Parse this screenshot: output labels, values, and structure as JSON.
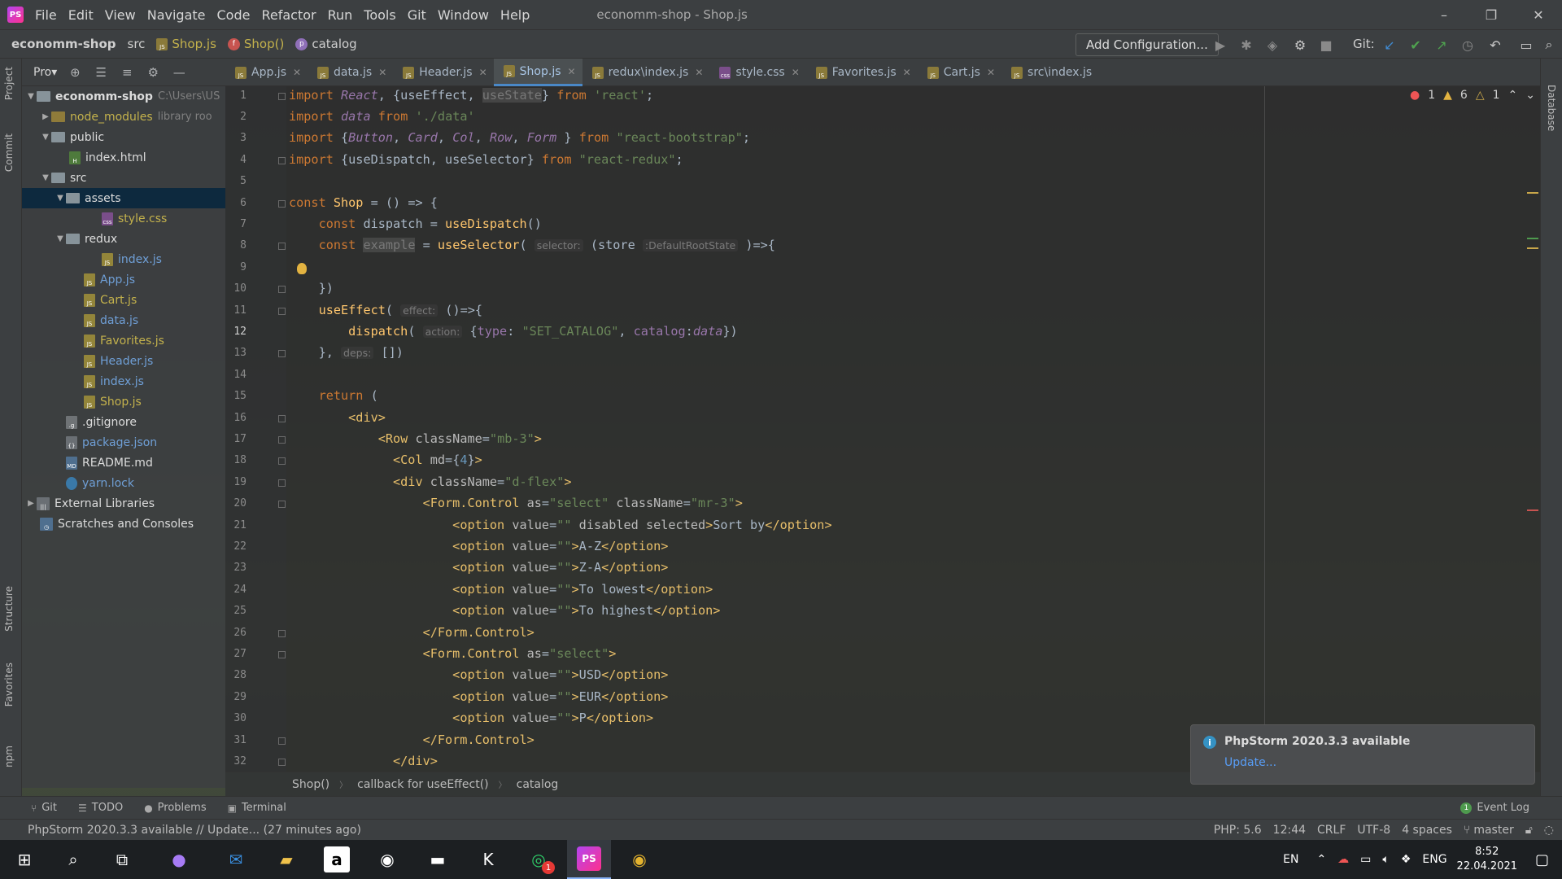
{
  "menubar": {
    "items": [
      "File",
      "Edit",
      "View",
      "Navigate",
      "Code",
      "Refactor",
      "Run",
      "Tools",
      "Git",
      "Window",
      "Help"
    ],
    "window_title": "economm-shop - Shop.js",
    "controls": [
      "–",
      "❐",
      "✕"
    ]
  },
  "nav": {
    "project": "economm-shop",
    "folder": "src",
    "file": "Shop.js",
    "function": "Shop()",
    "symbol": "catalog",
    "add_config": "Add Configuration...",
    "git_label": "Git:"
  },
  "left_strip": [
    "Project",
    "Commit",
    "Structure",
    "Favorites",
    "npm"
  ],
  "right_strip": [
    "Database"
  ],
  "project_panel": {
    "title": "Pro▾",
    "tree": [
      {
        "label": "economm-shop",
        "extra": "C:\\Users\\US"
      },
      {
        "label": "node_modules",
        "extra": "library roo"
      },
      {
        "label": "public"
      },
      {
        "label": "index.html"
      },
      {
        "label": "src"
      },
      {
        "label": "assets"
      },
      {
        "label": "style.css"
      },
      {
        "label": "redux"
      },
      {
        "label": "index.js"
      },
      {
        "label": "App.js"
      },
      {
        "label": "Cart.js"
      },
      {
        "label": "data.js"
      },
      {
        "label": "Favorites.js"
      },
      {
        "label": "Header.js"
      },
      {
        "label": "index.js"
      },
      {
        "label": "Shop.js"
      },
      {
        "label": ".gitignore"
      },
      {
        "label": "package.json"
      },
      {
        "label": "README.md"
      },
      {
        "label": "yarn.lock"
      },
      {
        "label": "External Libraries"
      },
      {
        "label": "Scratches and Consoles"
      }
    ]
  },
  "tabs": [
    "App.js",
    "data.js",
    "Header.js",
    "Shop.js",
    "redux\\index.js",
    "style.css",
    "Favorites.js",
    "Cart.js",
    "src\\index.js"
  ],
  "inspections": {
    "errors": "1",
    "warnings": "6",
    "weak": "1"
  },
  "code_breadcrumbs": [
    "Shop()",
    "callback for useEffect()",
    "catalog"
  ],
  "notification": {
    "title": "PhpStorm 2020.3.3 available",
    "link": "Update..."
  },
  "bottom_tools": [
    "Git",
    "TODO",
    "Problems",
    "Terminal"
  ],
  "event_log": "Event Log",
  "status": {
    "message": "PhpStorm 2020.3.3 available // Update... (27 minutes ago)",
    "php": "PHP: 5.6",
    "position": "12:44",
    "line_sep": "CRLF",
    "encoding": "UTF-8",
    "indent": "4 spaces",
    "branch": "master"
  },
  "taskbar": {
    "lang1": "EN",
    "lang2": "ENG",
    "time": "8:52",
    "date": "22.04.2021",
    "whatsapp_badge": "1"
  }
}
